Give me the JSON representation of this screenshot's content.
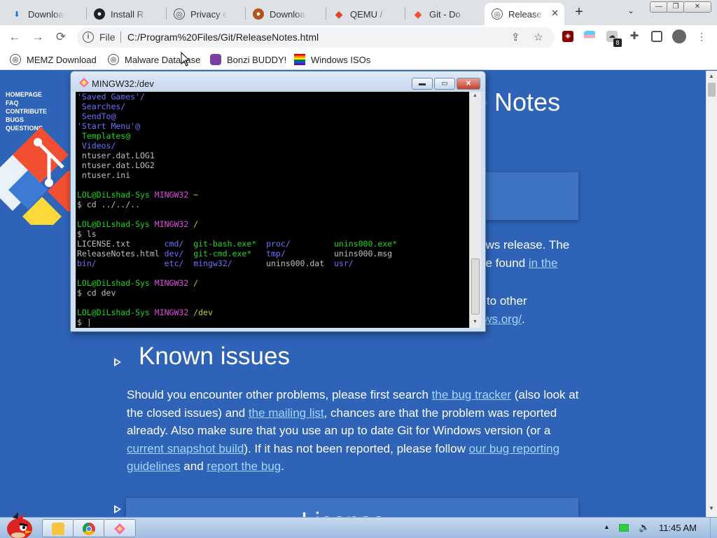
{
  "browser": {
    "tabs": [
      {
        "label": "Download",
        "icon": "download-icon"
      },
      {
        "label": "Install R",
        "icon": "github-icon"
      },
      {
        "label": "Privacy e",
        "icon": "globe-icon"
      },
      {
        "label": "Download",
        "icon": "site-icon"
      },
      {
        "label": "QEMU /",
        "icon": "gitlab-icon"
      },
      {
        "label": "Git - Do",
        "icon": "git-icon"
      },
      {
        "label": "Release",
        "icon": "globe-icon",
        "active": true
      }
    ],
    "nav": {
      "back": "←",
      "forward": "→",
      "reload": "⟳"
    },
    "omnibox": {
      "info": "i",
      "scheme": "File",
      "url": "C:/Program%20Files/Git/ReleaseNotes.html"
    },
    "extensions": {
      "badge": "8"
    },
    "bookmarks": [
      {
        "label": "MEMZ Download",
        "icon": "globe-icon"
      },
      {
        "label": "Malware Database",
        "icon": "globe-icon"
      },
      {
        "label": "Bonzi BUDDY!",
        "icon": "bonzi-icon"
      },
      {
        "label": "Windows ISOs",
        "icon": "windows-flag-icon"
      }
    ]
  },
  "page": {
    "sidebar": [
      "HOMEPAGE",
      "FAQ",
      "CONTRIBUTE",
      "BUGS",
      "QUESTIONS"
    ],
    "heading_fragment": "e Notes",
    "text_fragment_1_a": "ows release. The",
    "text_fragment_1_b_text": " be found ",
    "text_fragment_1_b_link": "in the",
    "text_fragment_2_a": "ts to other",
    "text_fragment_2_link": "lows.org/",
    "text_fragment_2_end": ".",
    "known_issues_title": "Known issues",
    "known_issues": {
      "t1": "Should you encounter other problems, please first search ",
      "l1": "the bug tracker",
      "t2": " (also look at the closed issues) and ",
      "l2": "the mailing list",
      "t3": ", chances are that the problem was reported already. Also make sure that you use an up to date Git for Windows version (or a ",
      "l3": "current snapshot build",
      "t4": "). If it has not been reported, please follow ",
      "l4": "our bug reporting guidelines",
      "t5": " and ",
      "l5": "report the bug",
      "t6": "."
    },
    "next_section_fragment": "License"
  },
  "terminal": {
    "title": "MINGW32:/dev",
    "lines": [
      [
        {
          "t": "'Saved Games'/",
          "c": "blue"
        }
      ],
      [
        {
          "t": " Searches/",
          "c": "blue"
        }
      ],
      [
        {
          "t": " SendTo@",
          "c": "blue"
        }
      ],
      [
        {
          "t": "'Start Menu'@",
          "c": "blue"
        }
      ],
      [
        {
          "t": " Templates@",
          "c": "green"
        }
      ],
      [
        {
          "t": " Videos/",
          "c": "blue"
        }
      ],
      [
        {
          "t": " ntuser.dat.LOG1",
          "c": "def"
        }
      ],
      [
        {
          "t": " ntuser.dat.LOG2",
          "c": "def"
        }
      ],
      [
        {
          "t": " ntuser.ini",
          "c": "def"
        }
      ],
      [
        {
          "t": "",
          "c": "def"
        }
      ],
      [
        {
          "t": "LOL@DiLshad-Sys ",
          "c": "green"
        },
        {
          "t": "MINGW32 ",
          "c": "mag"
        },
        {
          "t": "~",
          "c": "yel"
        }
      ],
      [
        {
          "t": "$ cd ../../..",
          "c": "def"
        }
      ],
      [
        {
          "t": "",
          "c": "def"
        }
      ],
      [
        {
          "t": "LOL@DiLshad-Sys ",
          "c": "green"
        },
        {
          "t": "MINGW32 ",
          "c": "mag"
        },
        {
          "t": "/",
          "c": "yel"
        }
      ],
      [
        {
          "t": "$ ls",
          "c": "def"
        }
      ],
      [
        {
          "t": "LICENSE.txt       ",
          "c": "def"
        },
        {
          "t": "cmd/",
          "c": "blue"
        },
        {
          "t": "  ",
          "c": "def"
        },
        {
          "t": "git-bash.exe*",
          "c": "green"
        },
        {
          "t": "  ",
          "c": "def"
        },
        {
          "t": "proc/",
          "c": "blue"
        },
        {
          "t": "         ",
          "c": "def"
        },
        {
          "t": "unins000.exe*",
          "c": "green"
        }
      ],
      [
        {
          "t": "ReleaseNotes.html ",
          "c": "def"
        },
        {
          "t": "dev/",
          "c": "blue"
        },
        {
          "t": "  ",
          "c": "def"
        },
        {
          "t": "git-cmd.exe*",
          "c": "green"
        },
        {
          "t": "   ",
          "c": "def"
        },
        {
          "t": "tmp/",
          "c": "blue"
        },
        {
          "t": "          unins000.msg",
          "c": "def"
        }
      ],
      [
        {
          "t": "bin/",
          "c": "blue"
        },
        {
          "t": "              ",
          "c": "def"
        },
        {
          "t": "etc/",
          "c": "blue"
        },
        {
          "t": "  ",
          "c": "def"
        },
        {
          "t": "mingw32/",
          "c": "blue"
        },
        {
          "t": "       unins000.dat  ",
          "c": "def"
        },
        {
          "t": "usr/",
          "c": "blue"
        }
      ],
      [
        {
          "t": "",
          "c": "def"
        }
      ],
      [
        {
          "t": "LOL@DiLshad-Sys ",
          "c": "green"
        },
        {
          "t": "MINGW32 ",
          "c": "mag"
        },
        {
          "t": "/",
          "c": "yel"
        }
      ],
      [
        {
          "t": "$ cd dev",
          "c": "def"
        }
      ],
      [
        {
          "t": "",
          "c": "def"
        }
      ],
      [
        {
          "t": "LOL@DiLshad-Sys ",
          "c": "green"
        },
        {
          "t": "MINGW32 ",
          "c": "mag"
        },
        {
          "t": "/dev",
          "c": "yel"
        }
      ],
      [
        {
          "t": "$ |",
          "c": "def"
        }
      ]
    ]
  },
  "taskbar": {
    "clock": "11:45 AM",
    "buttons": [
      "file-explorer-button",
      "chrome-button",
      "git-bash-button"
    ]
  }
}
